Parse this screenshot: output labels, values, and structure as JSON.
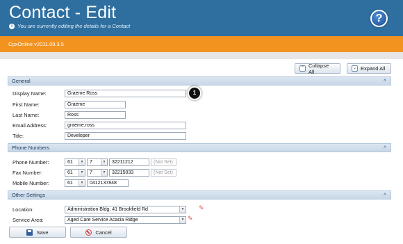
{
  "header": {
    "title": "Contact - Edit",
    "subtitle": "You are currently editing the details for a Contact",
    "help_symbol": "?"
  },
  "app": {
    "version": "CpxOnline v2011.09.3.5"
  },
  "toolbar": {
    "collapse_all": "Collapse All",
    "expand_all": "Expand All"
  },
  "sections": {
    "general": {
      "title": "General",
      "display_name_label": "Display Name:",
      "display_name_value": "Graeme Ross",
      "first_name_label": "First Name:",
      "first_name_value": "Graeme",
      "last_name_label": "Last Name:",
      "last_name_value": "Ross",
      "email_label": "Email Address:",
      "email_value": "graeme.ross",
      "title_label": "Title:",
      "title_value": "Developer"
    },
    "phone": {
      "title": "Phone Numbers",
      "phone_label": "Phone Number:",
      "phone_country": "61",
      "phone_area": "7",
      "phone_number": "32211212",
      "phone_ext": "(Not Set)",
      "fax_label": "Fax Number:",
      "fax_country": "61",
      "fax_area": "7",
      "fax_number": "32215033",
      "fax_ext": "(Not Set)",
      "mobile_label": "Mobile Number:",
      "mobile_country": "61",
      "mobile_number": "0412137848"
    },
    "other": {
      "title": "Other Settings",
      "location_label": "Location:",
      "location_value": "Administration Bldg, 41 Brookfield Rd",
      "service_area_label": "Service Area:",
      "service_area_value": "Aged Care Service Acacia Ridge"
    }
  },
  "callout": {
    "number": "1"
  },
  "actions": {
    "save": "Save",
    "cancel": "Cancel"
  },
  "colors": {
    "header_blue": "#2e6fa0",
    "orange": "#f2921f",
    "section_blue": "#c8d7e7"
  },
  "icons": {
    "info": "info-icon",
    "help": "help-icon",
    "save": "save-icon",
    "cancel": "cancel-icon",
    "clear": "eraser-icon"
  }
}
